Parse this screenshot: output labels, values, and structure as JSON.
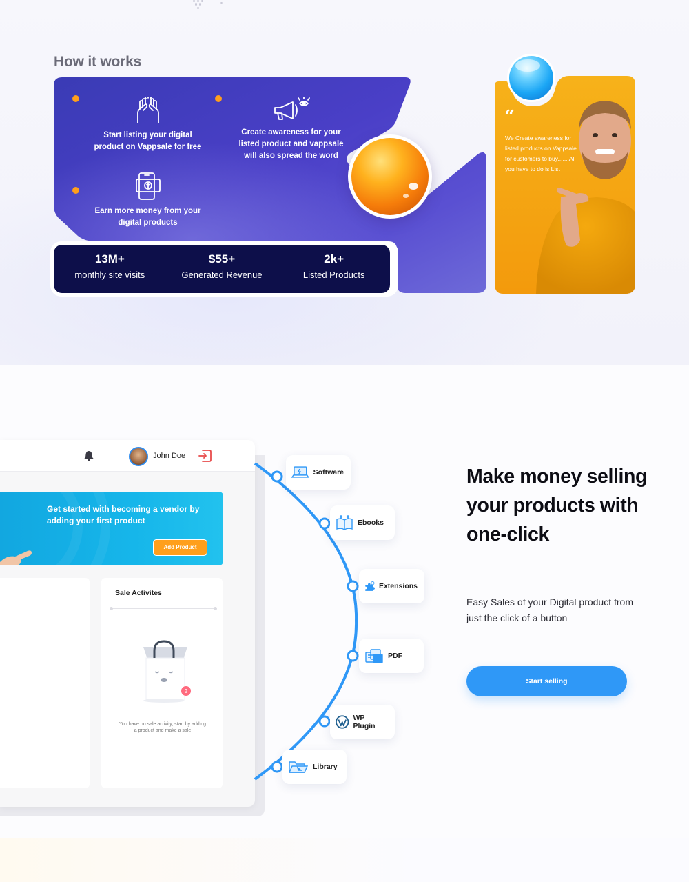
{
  "how_it_works": {
    "title": "How it works",
    "features": [
      {
        "icon": "hands-up-icon",
        "text": "Start listing your digital product on Vappsale for free"
      },
      {
        "icon": "megaphone-icon",
        "text": "Create awareness for your listed product and vappsale will also spread the word"
      },
      {
        "icon": "money-phone-icon",
        "text": "Earn more money from your digital products"
      }
    ],
    "stats": [
      {
        "value": "13M+",
        "label": "monthly site visits"
      },
      {
        "value": "$55+",
        "label": "Generated Revenue"
      },
      {
        "value": "2k+",
        "label": "Listed Products"
      }
    ],
    "testimonial": {
      "quote_mark": "“",
      "text": "We Create awareness for listed products on Vappsale for customers to buy.......All you have to do is List"
    }
  },
  "dashboard": {
    "user_name": "John Doe",
    "banner_text": "Get started with becoming a vendor by adding your first product",
    "add_product_label": "Add Product",
    "sale_panel_title": "Sale Activites",
    "notification_count": "2",
    "empty_text": "You have no sale activity, start by adding a product and make a sale"
  },
  "categories": [
    {
      "label": "Software",
      "icon": "laptop-icon"
    },
    {
      "label": "Ebooks",
      "icon": "book-icon"
    },
    {
      "label": "Extensions",
      "icon": "puzzle-icon"
    },
    {
      "label": "PDF",
      "icon": "documents-icon"
    },
    {
      "label": "WP Plugin",
      "icon": "wordpress-icon"
    },
    {
      "label": "Library",
      "icon": "folder-icon"
    }
  ],
  "promo": {
    "headline": "Make money selling your products with one-click",
    "subtext": "Easy Sales of your Digital product from just the click of a button",
    "cta_label": "Start selling"
  },
  "colors": {
    "card_purple": "#4a3fc7",
    "stats_navy": "#0d0f4a",
    "accent_orange": "#ff9f1c",
    "testimonial_orange": "#f7a812",
    "primary_blue": "#2f98f7",
    "banner_cyan": "#16b6ea"
  }
}
